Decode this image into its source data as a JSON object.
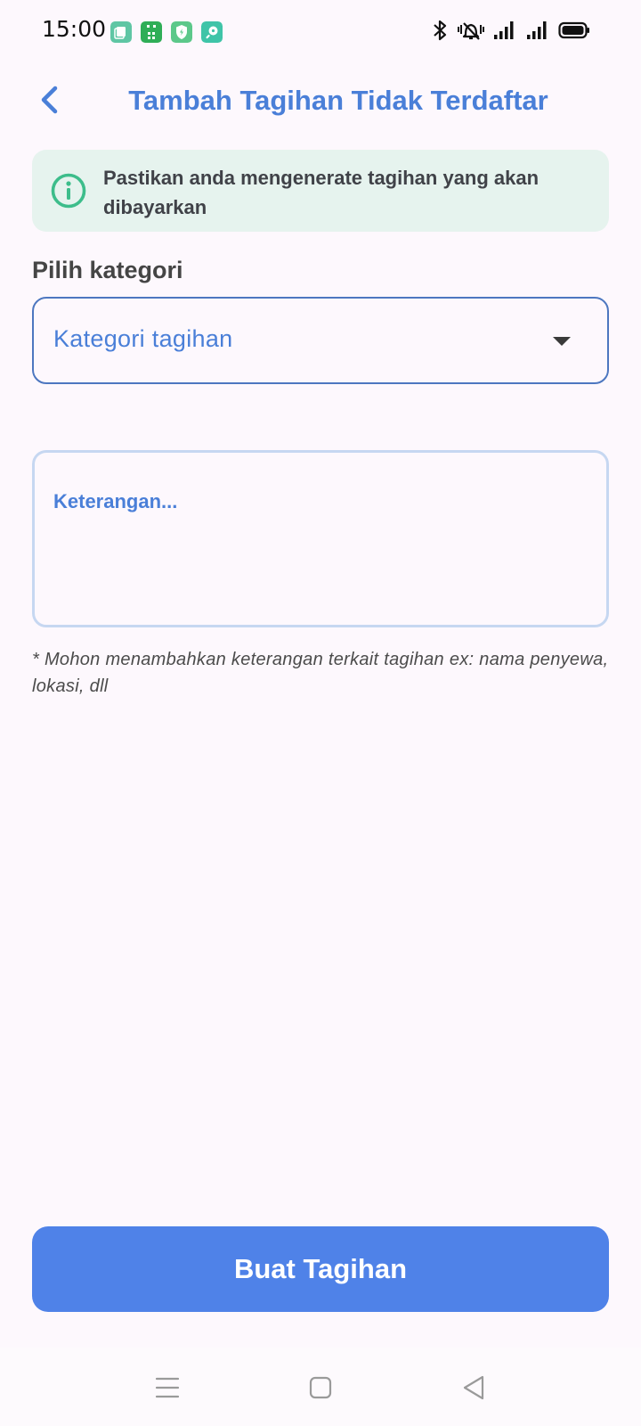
{
  "status_bar": {
    "time": "15:00",
    "notification_icons": [
      {
        "name": "copy-app-icon",
        "color": "#5fc6a4"
      },
      {
        "name": "grid-app-icon",
        "color": "#2fae57"
      },
      {
        "name": "shield-app-icon",
        "color": "#5cc88a"
      },
      {
        "name": "search-app-icon",
        "color": "#3fc4a8"
      }
    ],
    "system_icons": [
      "bluetooth-icon",
      "vibrate-mute-icon",
      "signal-icon",
      "signal-icon",
      "battery-icon"
    ]
  },
  "app_bar": {
    "title": "Tambah Tagihan Tidak Terdaftar",
    "back_icon": "chevron-left-icon"
  },
  "info_banner": {
    "icon": "info-icon",
    "text": "Pastikan anda mengenerate tagihan yang akan dibayarkan"
  },
  "category": {
    "label": "Pilih kategori",
    "placeholder": "Kategori tagihan",
    "icon": "dropdown-arrow-icon"
  },
  "description": {
    "placeholder": "Keterangan...",
    "helper": "* Mohon menambahkan keterangan terkait tagihan ex: nama penyewa, lokasi, dll"
  },
  "actions": {
    "submit_label": "Buat Tagihan"
  },
  "nav_bar": {
    "buttons": [
      "menu-icon",
      "home-icon",
      "back-icon"
    ]
  },
  "colors": {
    "accent": "#4a7fd8",
    "button": "#4f82e8",
    "banner_bg": "#e6f3ee",
    "info_icon": "#3dbd8b",
    "background": "#fdf8fd"
  }
}
